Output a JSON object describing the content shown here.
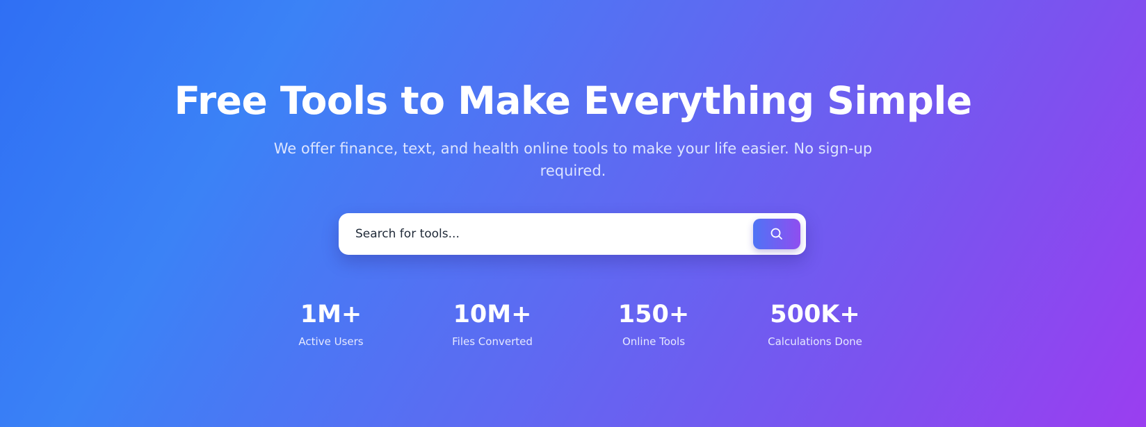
{
  "hero": {
    "title": "Free Tools to Make Everything Simple",
    "subtitle": "We offer finance, text, and health online tools to make your life easier. No sign-up required."
  },
  "search": {
    "placeholder": "Search for tools...",
    "value": "",
    "button_icon": "search-icon"
  },
  "stats": [
    {
      "value": "1M+",
      "label": "Active Users"
    },
    {
      "value": "10M+",
      "label": "Files Converted"
    },
    {
      "value": "150+",
      "label": "Online Tools"
    },
    {
      "value": "500K+",
      "label": "Calculations Done"
    }
  ],
  "colors": {
    "gradient_start": "#2f6ff4",
    "gradient_mid": "#5b6cf2",
    "gradient_end": "#9a3ef0",
    "search_button_start": "#4f74f5",
    "search_button_end": "#8f4ef0",
    "text_primary": "#ffffff"
  }
}
